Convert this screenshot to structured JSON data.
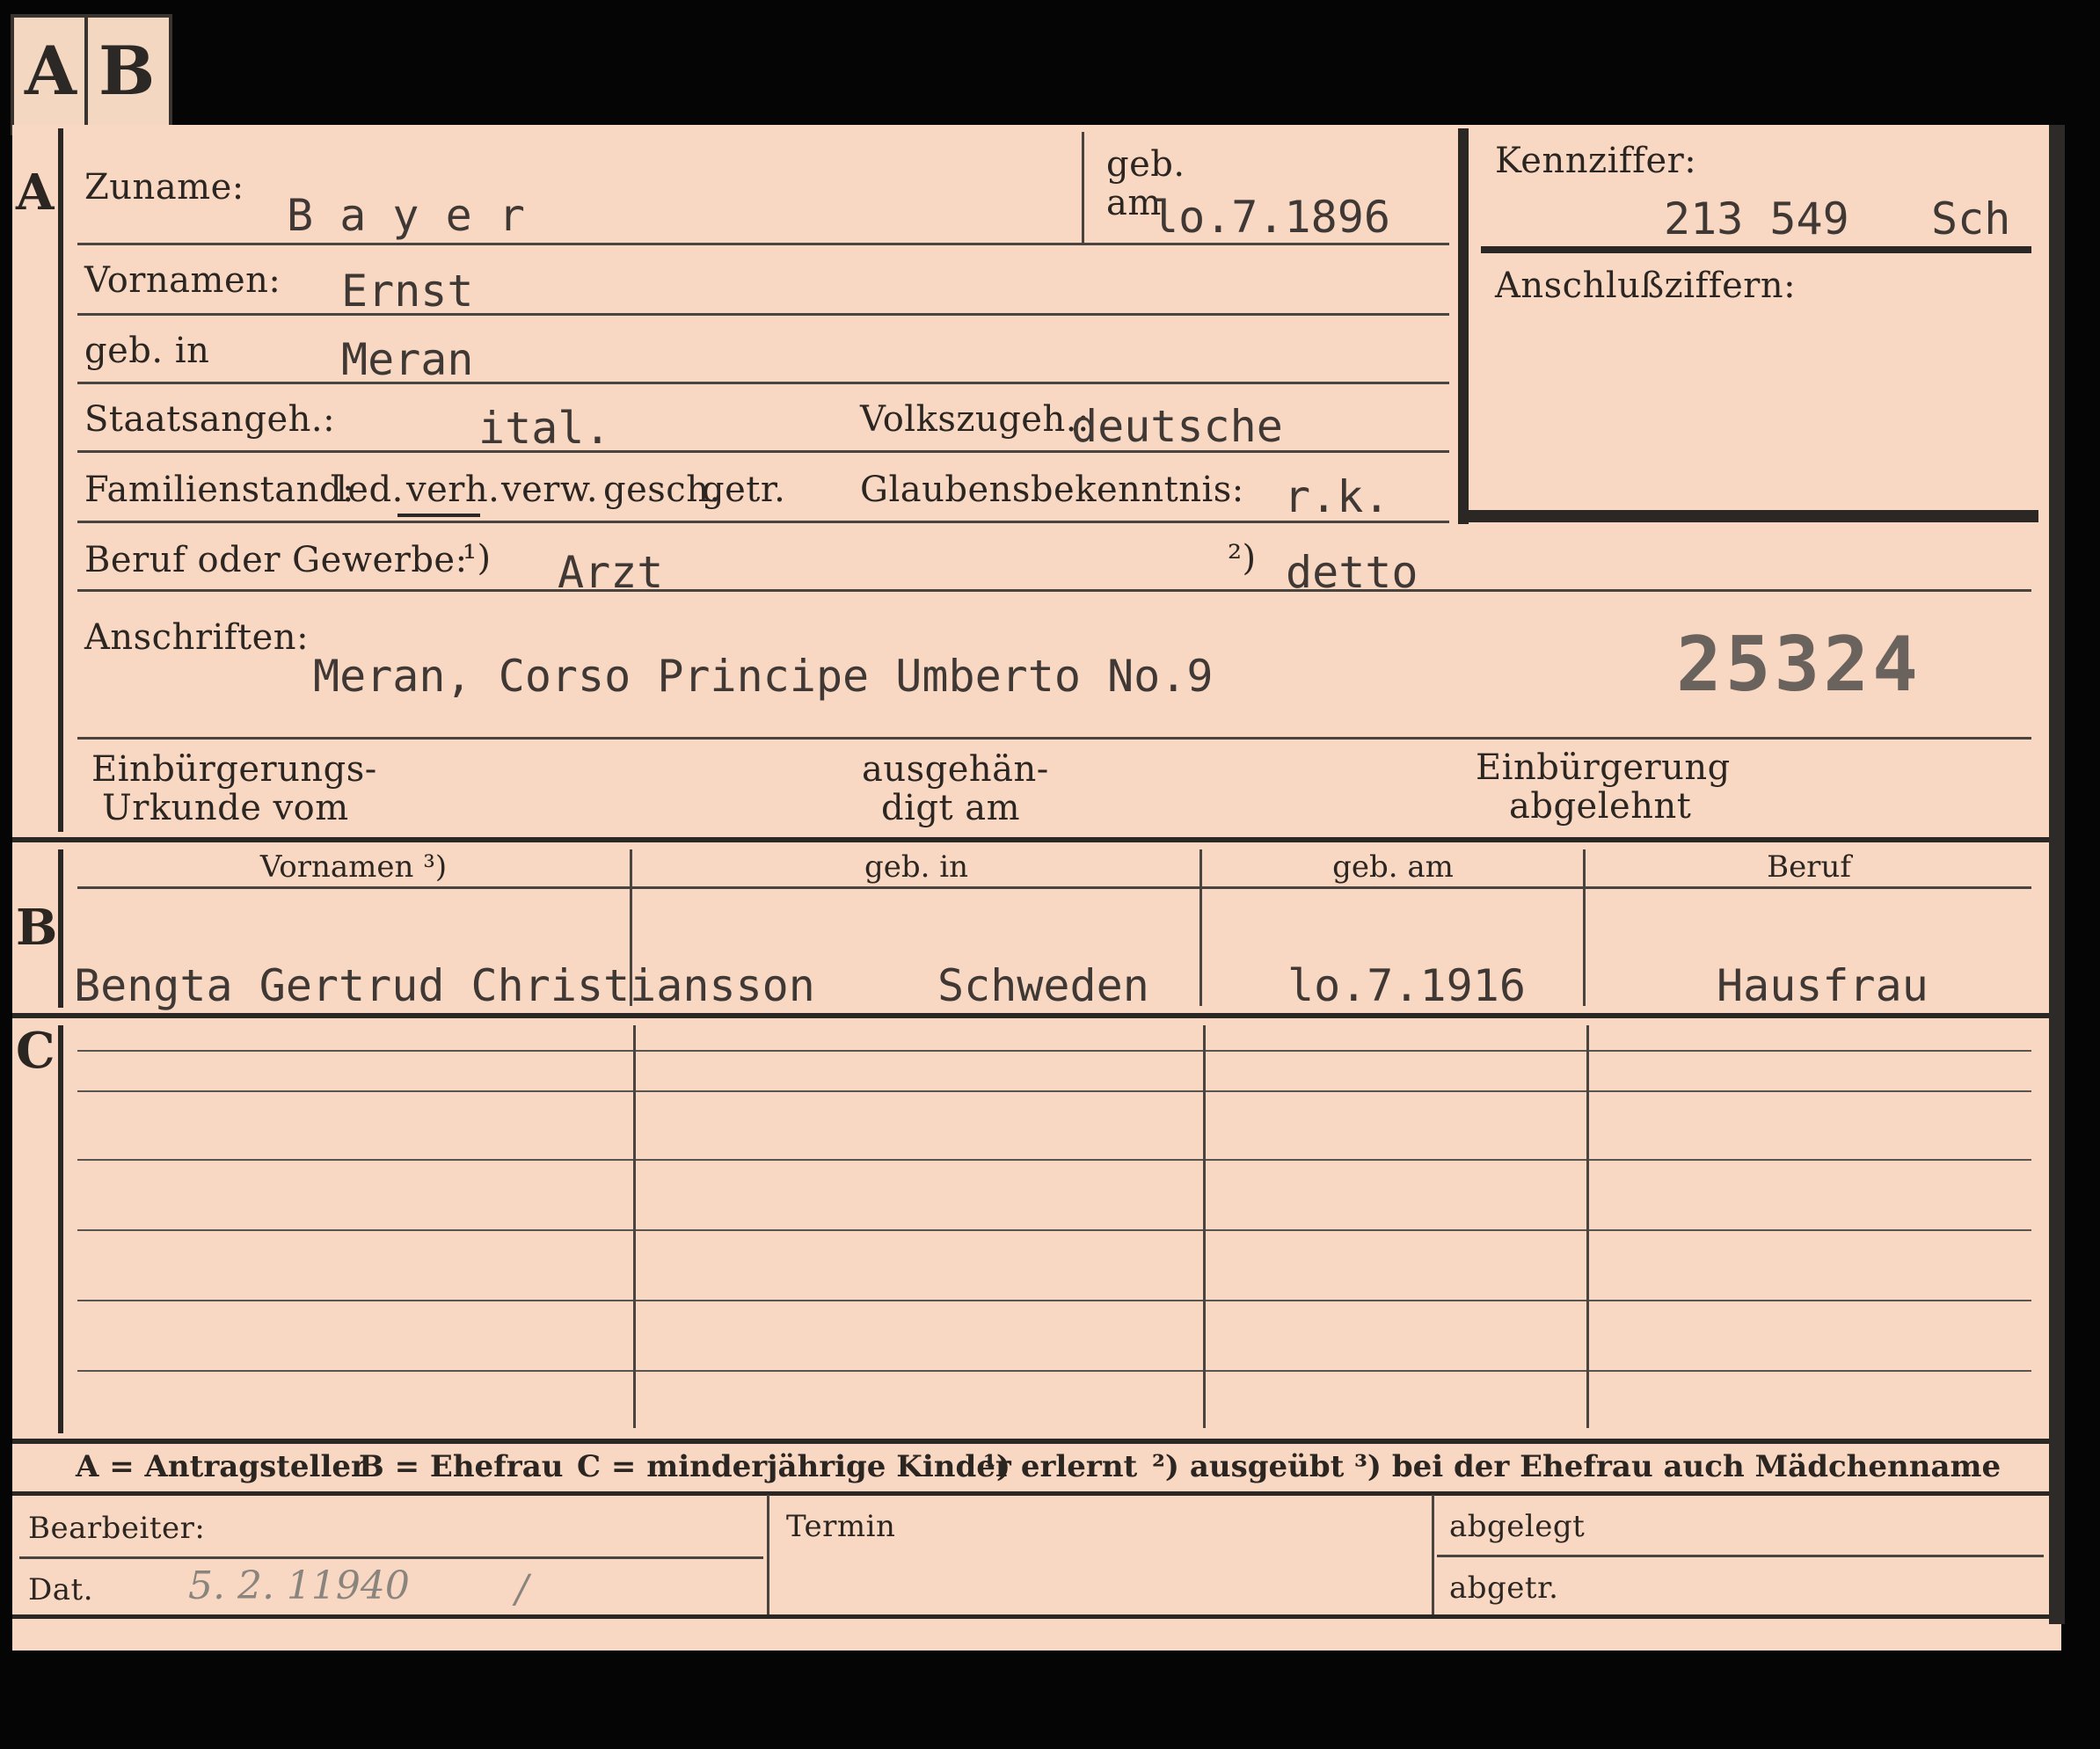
{
  "tabs": {
    "a": "A",
    "b": "B"
  },
  "sections": {
    "a": "A",
    "b": "B",
    "c": "C"
  },
  "section_a": {
    "zuname_label": "Zuname:",
    "zuname_value": "B a y e r",
    "geb_label": "geb.",
    "am_label": "am",
    "geb_am_value": "lo.7.1896",
    "kennziffer_label": "Kennziffer:",
    "kennziffer_value": "213 549",
    "kennziffer_suffix": "Sch",
    "anschluss_label": "Anschlußziffern:",
    "vornamen_label": "Vornamen:",
    "vornamen_value": "Ernst",
    "geb_in_label": "geb. in",
    "geb_in_value": "Meran",
    "staats_label": "Staatsangeh.:",
    "staats_value": "ital.",
    "volks_label": "Volkszugeh.:",
    "volks_value": "deutsche",
    "familien_label": "Familienstand:",
    "familien_options": {
      "led": "led.",
      "verh": "verh.",
      "verw": "verw.",
      "gesch": "gesch.",
      "getr": "getr."
    },
    "glaubens_label": "Glaubensbekenntnis:",
    "glaubens_value": "r.k.",
    "beruf_label": "Beruf oder Gewerbe:",
    "beruf_note1": "¹)",
    "beruf_value1": "Arzt",
    "beruf_note2": "²)",
    "beruf_value2": "detto",
    "anschriften_label": "Anschriften:",
    "anschriften_value": "Meran, Corso Principe Umberto No.9",
    "stamp_number": "25324",
    "einbuerg_label_1": "Einbürgerungs-",
    "einbuerg_label_2": "Urkunde vom",
    "ausgeh_label_1": "ausgehän-",
    "ausgeh_label_2": "digt am",
    "abgelehnt_label_1": "Einbürgerung",
    "abgelehnt_label_2": "abgelehnt"
  },
  "section_b": {
    "headers": {
      "vornamen": "Vornamen ³)",
      "geb_in": "geb. in",
      "geb_am": "geb. am",
      "beruf": "Beruf"
    },
    "row": {
      "vornamen": "Bengta Gertrud Christiansson",
      "geb_in": "Schweden",
      "geb_am": "lo.7.1916",
      "beruf": "Hausfrau"
    }
  },
  "legend": {
    "a": "A = Antragsteller",
    "b": "B = Ehefrau",
    "c": "C = minderjährige Kinder",
    "n1": "¹) erlernt",
    "n2": "²) ausgeübt",
    "n3": "³) bei der Ehefrau auch Mädchenname"
  },
  "footer": {
    "bearbeiter_label": "Bearbeiter:",
    "dat_label": "Dat.",
    "dat_value": "5. 2. 11940",
    "dat_slash": "/",
    "termin_label": "Termin",
    "abgelegt_label": "abgelegt",
    "abgetr_label": "abgetr."
  }
}
